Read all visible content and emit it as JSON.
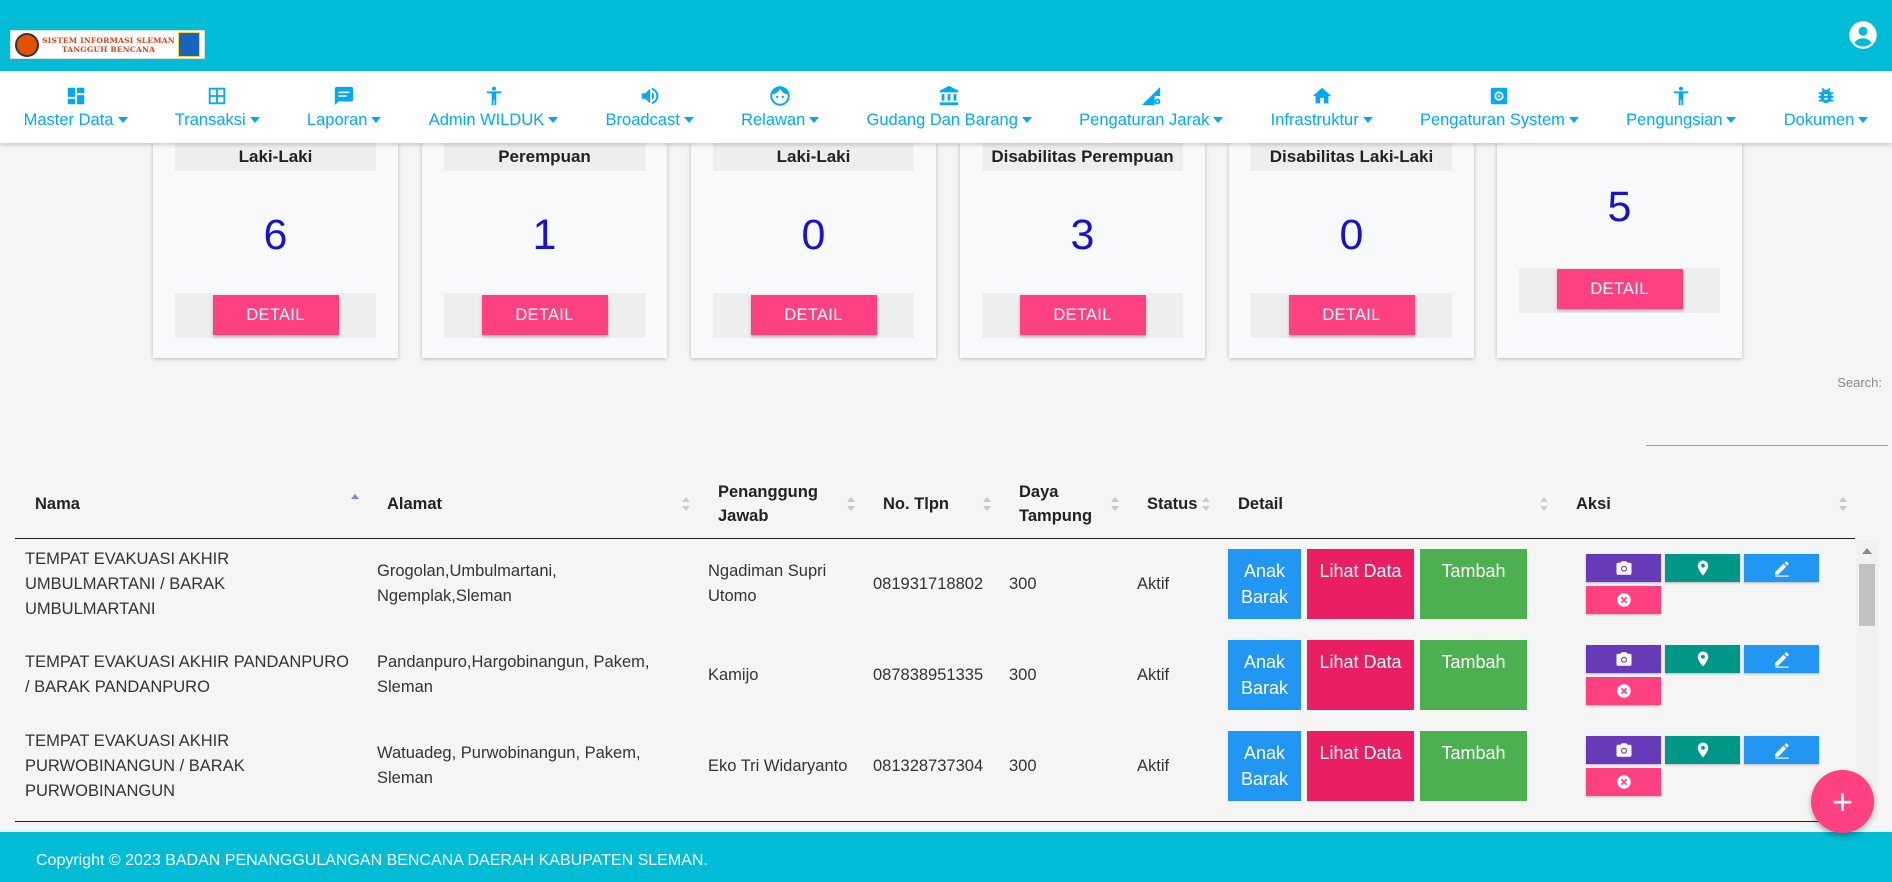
{
  "header": {
    "logo_text": "SISTEM INFORMASI SLEMAN TANGGUH BENCANA"
  },
  "nav": [
    {
      "label": "Master Data",
      "icon": "dashboard-icon"
    },
    {
      "label": "Transaksi",
      "icon": "grid-icon"
    },
    {
      "label": "Laporan",
      "icon": "chat-icon"
    },
    {
      "label": "Admin WILDUK",
      "icon": "person-icon"
    },
    {
      "label": "Broadcast",
      "icon": "speaker-icon"
    },
    {
      "label": "Relawan",
      "icon": "face-icon"
    },
    {
      "label": "Gudang Dan Barang",
      "icon": "bank-icon"
    },
    {
      "label": "Pengaturan Jarak",
      "icon": "signal-gear-icon"
    },
    {
      "label": "Infrastruktur",
      "icon": "home-icon"
    },
    {
      "label": "Pengaturan System",
      "icon": "settings-box-icon"
    },
    {
      "label": "Pengungsian",
      "icon": "person-icon"
    },
    {
      "label": "Dokumen",
      "icon": "bug-icon"
    }
  ],
  "cards": [
    {
      "title": "Laki-Laki",
      "value": "6",
      "button": "DETAIL"
    },
    {
      "title": "Perempuan",
      "value": "1",
      "button": "DETAIL"
    },
    {
      "title": "Laki-Laki",
      "value": "0",
      "button": "DETAIL"
    },
    {
      "title": "Disabilitas Perempuan",
      "value": "3",
      "button": "DETAIL"
    },
    {
      "title": "Disabilitas Laki-Laki",
      "value": "0",
      "button": "DETAIL"
    },
    {
      "title": "",
      "value": "5",
      "button": "DETAIL"
    }
  ],
  "search": {
    "label": "Search:",
    "value": ""
  },
  "table": {
    "columns": [
      "Nama",
      "Alamat",
      "Penanggung Jawab",
      "No. Tlpn",
      "Daya Tampung",
      "Status",
      "Detail",
      "Aksi"
    ],
    "buttons": {
      "anak_barak": "Anak Barak",
      "lihat_data": "Lihat Data",
      "tambah": "Tambah"
    },
    "rows": [
      {
        "nama": "TEMPAT EVAKUASI AKHIR UMBULMARTANI / BARAK UMBULMARTANI",
        "alamat": "Grogolan,Umbulmartani, Ngemplak,Sleman",
        "pj": "Ngadiman Supri Utomo",
        "tlpn": "081931718802",
        "daya": "300",
        "status": "Aktif"
      },
      {
        "nama": "TEMPAT EVAKUASI AKHIR PANDANPURO / BARAK PANDANPURO",
        "alamat": "Pandanpuro,Hargobinangun, Pakem, Sleman",
        "pj": "Kamijo",
        "tlpn": "087838951335",
        "daya": "300",
        "status": "Aktif"
      },
      {
        "nama": "TEMPAT EVAKUASI AKHIR PURWOBINANGUN / BARAK PURWOBINANGUN",
        "alamat": "Watuadeg, Purwobinangun, Pakem, Sleman",
        "pj": "Eko Tri Widaryanto",
        "tlpn": "081328737304",
        "daya": "300",
        "status": "Aktif"
      }
    ]
  },
  "fab": {
    "label": "+"
  },
  "footer": {
    "text": "Copyright © 2023 BADAN PENANGGULANGAN BENCANA DAERAH KABUPATEN SLEMAN."
  }
}
